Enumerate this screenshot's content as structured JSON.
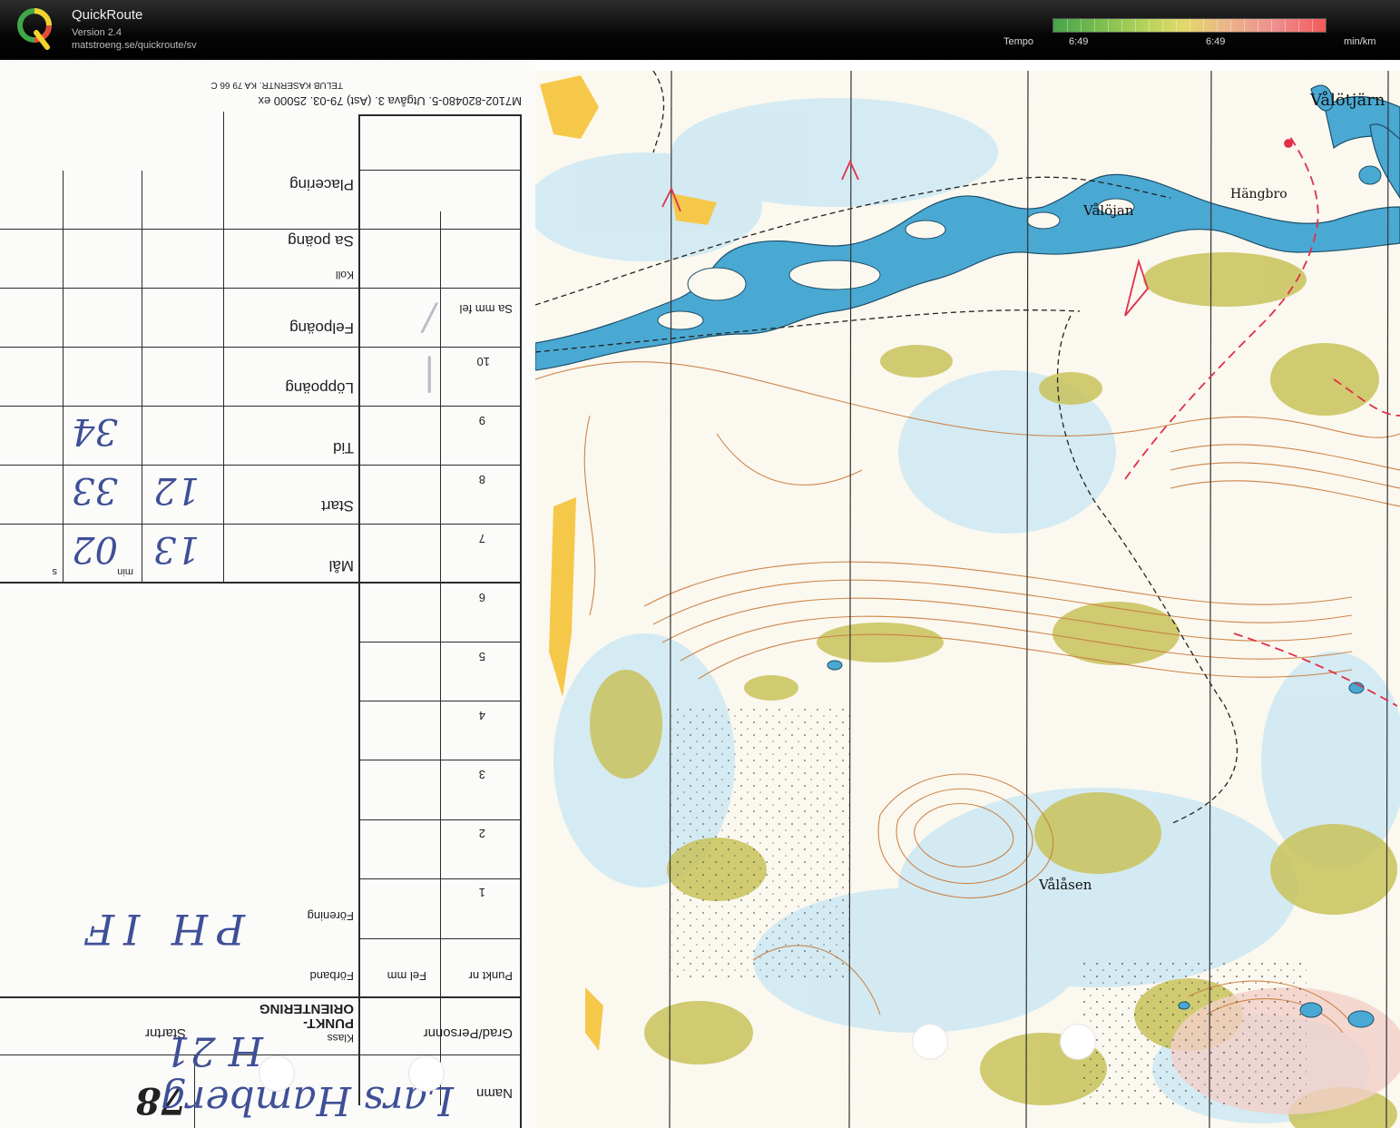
{
  "app": {
    "title": "QuickRoute",
    "version": "Version 2.4",
    "url": "matstroeng.se/quickroute/sv"
  },
  "tempo": {
    "label": "Tempo",
    "min": "6:49",
    "max": "6:49",
    "unit": "min/km",
    "gradient_colors": [
      "#47a34a",
      "#b7d35a",
      "#e3d86a",
      "#ef8d8d",
      "#f25a5a"
    ]
  },
  "card": {
    "print_line1": "TELUB KASERNTR. KA 79 66 C",
    "print_line2": "M7102-820480-5. Utgåva 3. (Ast) 79-03. 25000 ex",
    "rows": {
      "placering": "Placering",
      "sa_poang": "Sa poäng",
      "koll": "Koll",
      "felpoang": "Felpoäng",
      "sa_mm_fel": "Sa mm fel",
      "loppoang": "Löppoäng",
      "tid": "Tid",
      "start": "Start",
      "mal": "Mål",
      "min": "min",
      "s": "s",
      "forening": "Förening",
      "forband": "Förband",
      "klass": "Klass",
      "punkt_nr": "Punkt nr",
      "fel_mm": "Fel mm",
      "header": "PUNKT-ORIENTERING",
      "namn": "Namn",
      "grad_personnr": "Grad/Personnr",
      "startnr": "Startnr"
    },
    "control_numbers": [
      "10",
      "9",
      "8",
      "7",
      "6",
      "5",
      "4",
      "3",
      "2",
      "1"
    ],
    "handwritten": {
      "tid": "34",
      "start_h": "12",
      "start_m": "33",
      "mal_h": "13",
      "mal_m": "02",
      "forening": "PH IF",
      "klass": "H 21",
      "namn": "Lars Hamberg",
      "startnr": "78"
    }
  },
  "map": {
    "labels": {
      "vallojan": "Vålöjan",
      "hangbro": "Hängbro",
      "valotjarn": "Vålötjärn",
      "valasen": "Vålåsen"
    },
    "colors": {
      "water": "#4aa9d3",
      "open_land": "#f6c84a",
      "green": "#c8c25a",
      "contour": "#c97a3a",
      "course": "#e0304a"
    }
  }
}
